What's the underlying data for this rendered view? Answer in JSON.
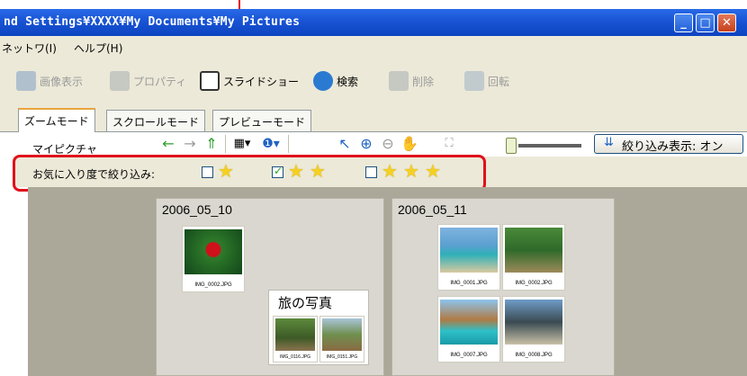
{
  "window": {
    "title": "nd Settings¥XXXX¥My Documents¥My Pictures"
  },
  "menu": {
    "items": [
      "ネットワ(I)",
      "ヘルプ(H)"
    ]
  },
  "toolbar": {
    "image_view": "画像表示",
    "properties": "プロパティ",
    "slideshow": "スライドショー",
    "search": "検索",
    "delete": "削除",
    "rotate": "回転"
  },
  "tabs": [
    {
      "label": "ズームモード",
      "active": true
    },
    {
      "label": "スクロールモード",
      "active": false
    },
    {
      "label": "プレビューモード",
      "active": false
    }
  ],
  "viewbar": {
    "folder": "マイピクチャ",
    "filter_button": "絞り込み表示: オン"
  },
  "filter": {
    "label": "お気に入り度で絞り込み:",
    "options": [
      {
        "stars": 1,
        "checked": false
      },
      {
        "stars": 2,
        "checked": true
      },
      {
        "stars": 3,
        "checked": false
      }
    ]
  },
  "groups": [
    {
      "date": "2006_05_10",
      "photos": [
        {
          "caption": "IMG_0002.JPG"
        }
      ],
      "album": {
        "name": "旅の写真",
        "photos": [
          {
            "caption": "IMG_0116.JPG"
          },
          {
            "caption": "IMG_0151.JPG"
          }
        ]
      }
    },
    {
      "date": "2006_05_11",
      "photos": [
        {
          "caption": "IMG_0001.JPG"
        },
        {
          "caption": "IMG_0002.JPG"
        },
        {
          "caption": "IMG_0007.JPG"
        },
        {
          "caption": "IMG_0008.JPG"
        }
      ]
    }
  ],
  "colors": {
    "highlight": "#e0101b",
    "titlebar": "#1a56d6",
    "toolbar_bg": "#ece9d8",
    "content_bg": "#aca899",
    "star": "#f5d020"
  }
}
